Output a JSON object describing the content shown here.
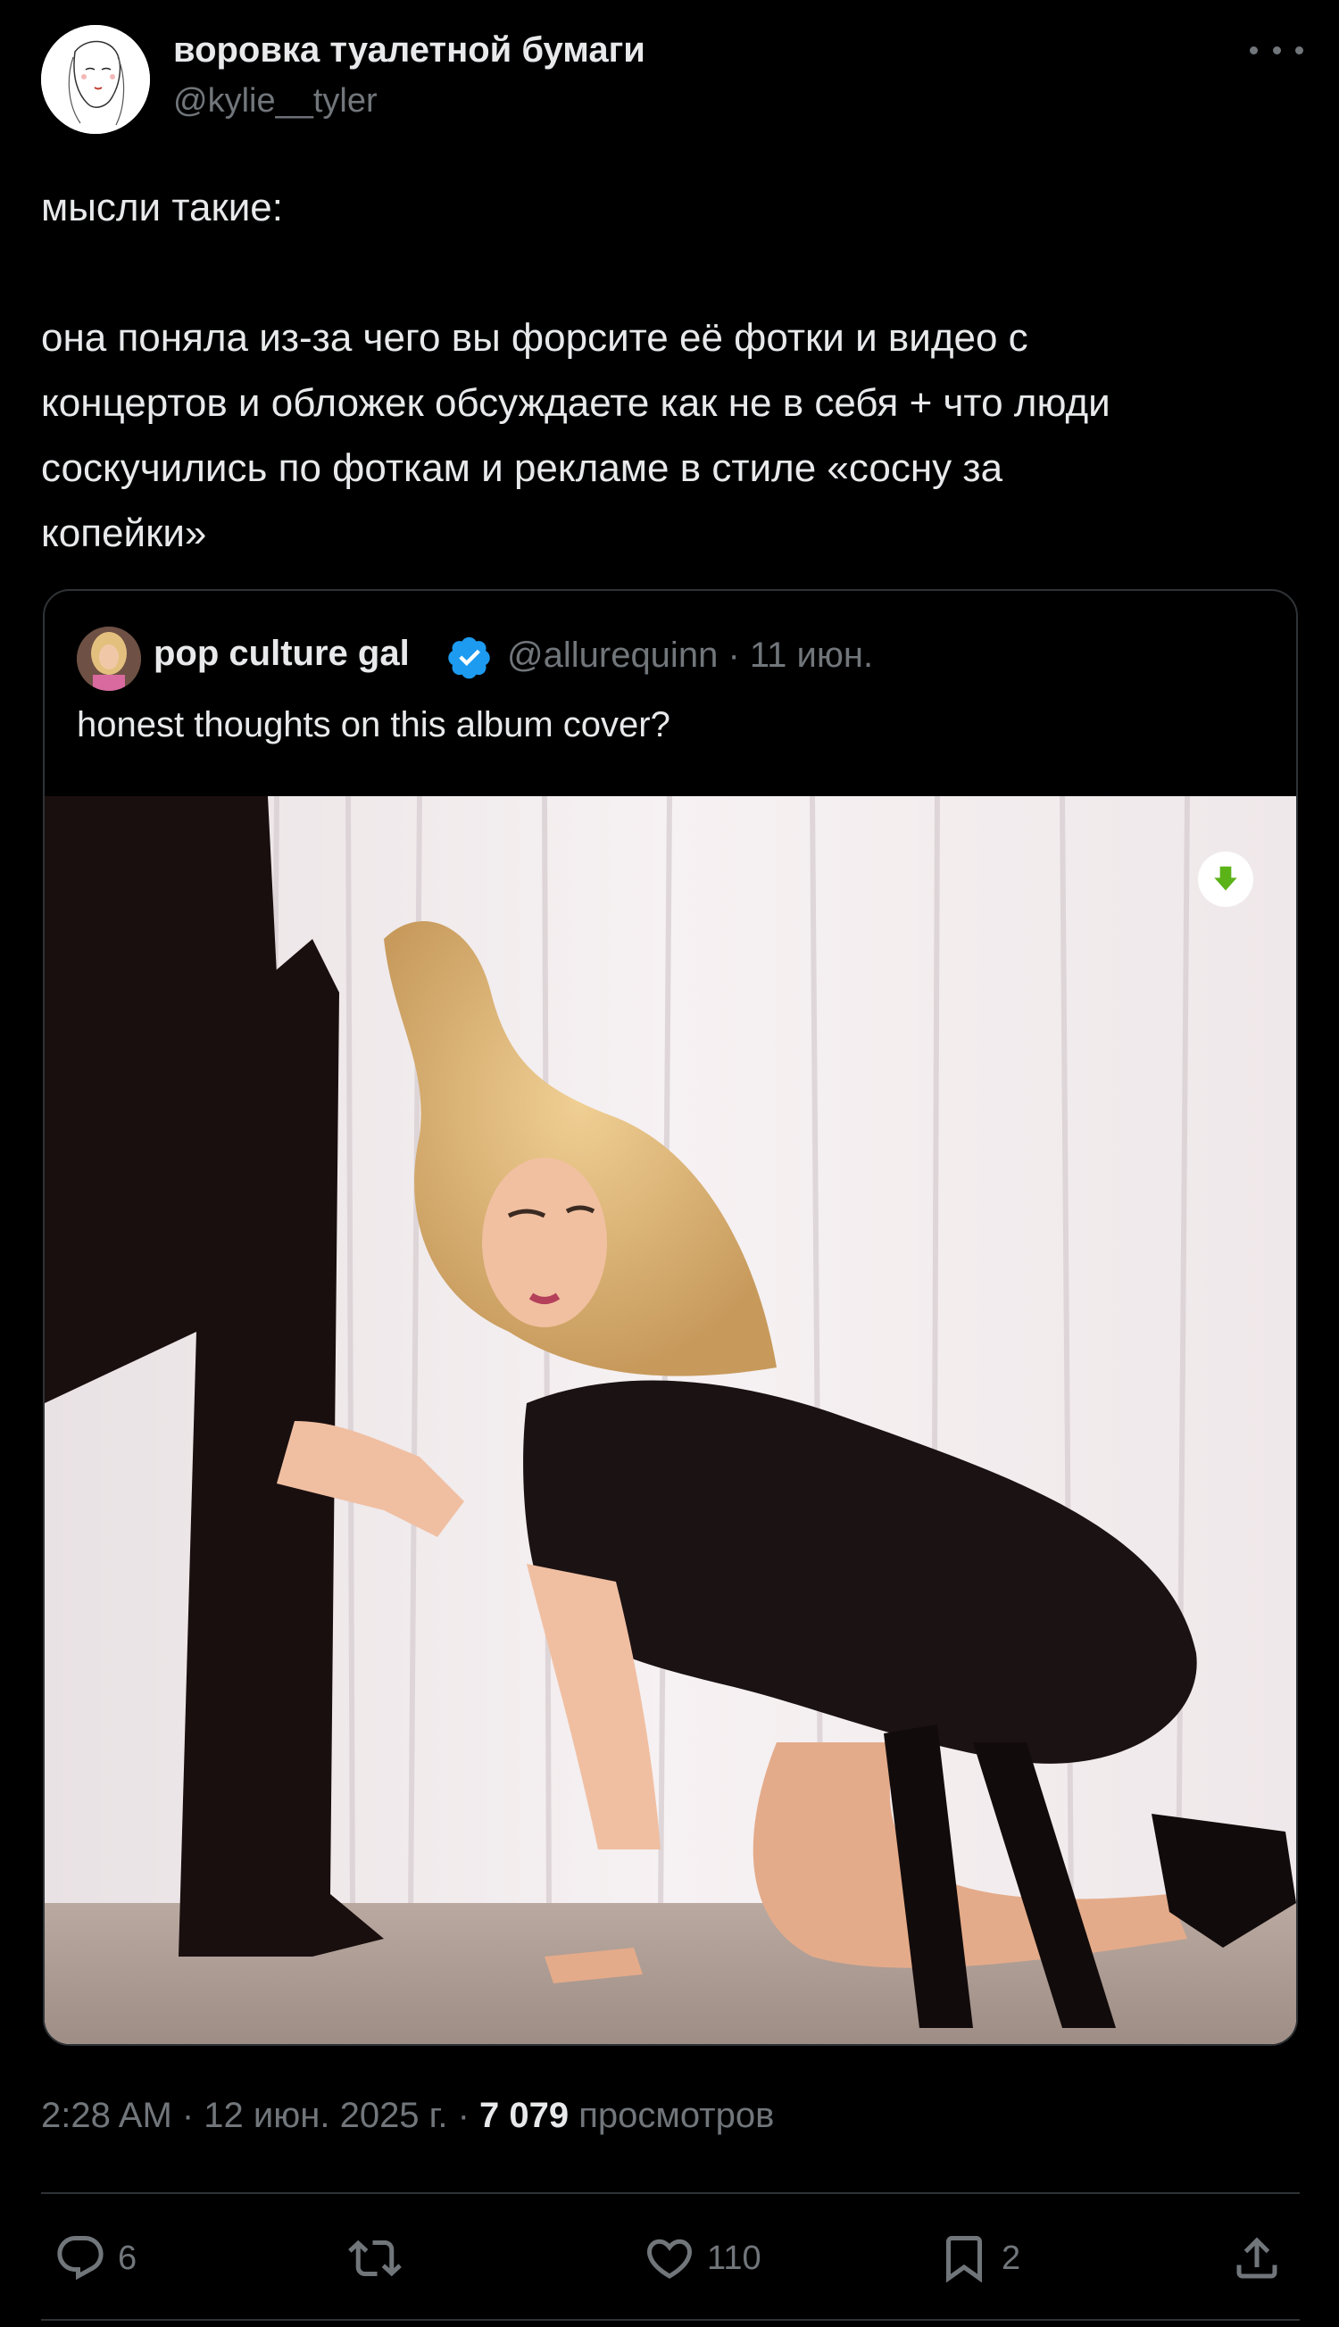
{
  "post": {
    "author_name": "воровка туалетной бумаги",
    "author_handle": "@kylie__tyler",
    "text": "мысли такие:\n\nона поняла из-за чего вы форсите её фотки и видео с\nконцертов и обложек обсуждаете как не в себя + что люди\nсоскучились по фоткам и рекламе в стиле «сосну за\nкопейки»"
  },
  "quote": {
    "author_name": "pop culture gal",
    "author_handle": "@allurequinn",
    "date": "· 11 июн.",
    "text": "honest thoughts on this album cover?"
  },
  "meta": {
    "time_date": "2:28 AM · 12 июн. 2025 г. · ",
    "views_count": "7 079",
    "views_label": " просмотров"
  },
  "actions": {
    "replies": "6",
    "retweets": "",
    "likes": "110",
    "bookmarks": "2"
  },
  "icons": [
    "more-icon",
    "verified-icon",
    "download-icon",
    "reply-icon",
    "retweet-icon",
    "like-icon",
    "bookmark-icon",
    "share-icon"
  ],
  "colors": {
    "background": "#000000",
    "text": "#e7e9ea",
    "muted": "#71767b",
    "border": "#2f3336",
    "verified": "#1d9bf0",
    "download": "#5bb318"
  }
}
